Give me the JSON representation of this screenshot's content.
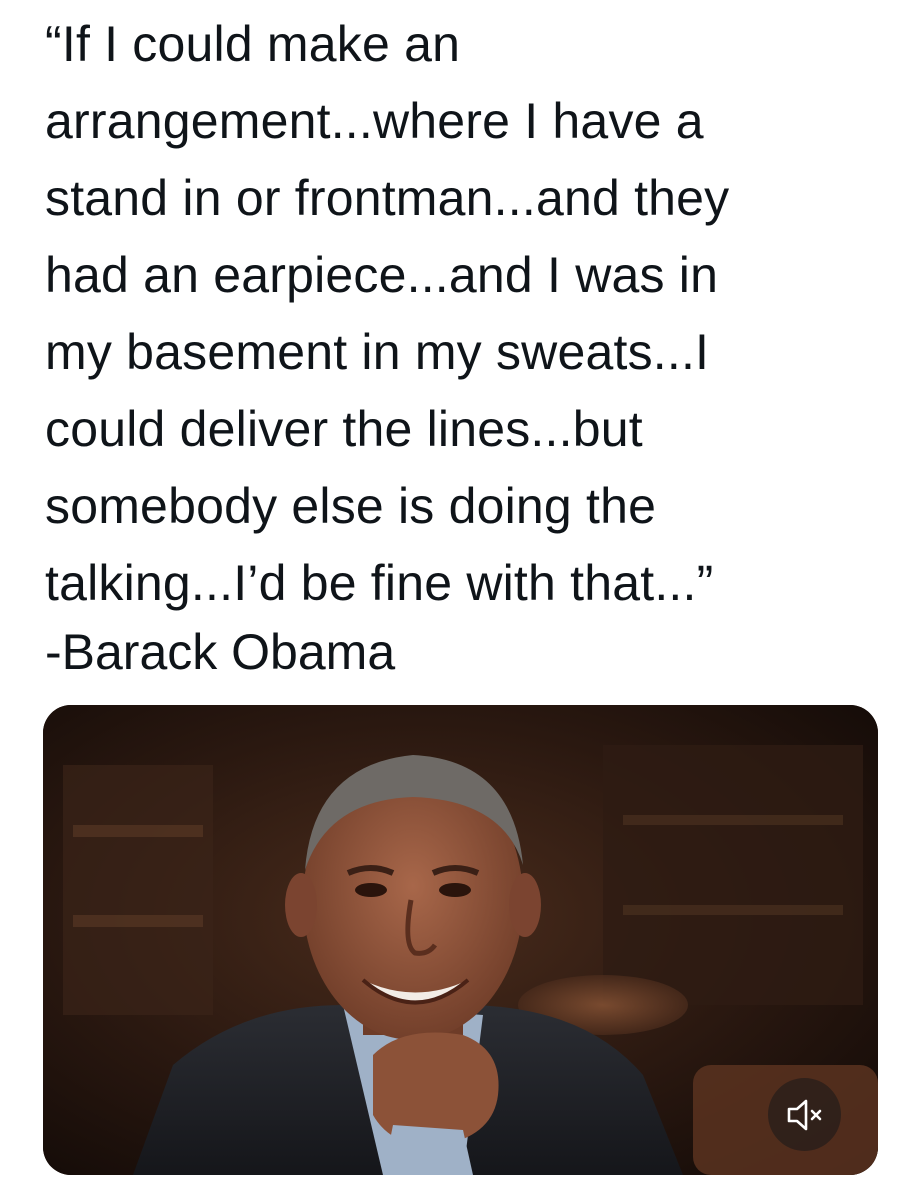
{
  "post": {
    "quote_lines": [
      "“If I could make an",
      "arrangement...where I have a",
      "stand in or frontman...and they",
      "had an earpiece...and I was in",
      "my basement in my sweats...I",
      "could deliver the lines...but",
      "somebody else is doing the",
      "talking...I’d be fine with that...”"
    ],
    "attribution": "-Barack Obama"
  },
  "media": {
    "type": "video",
    "mute_icon": "speaker-muted-icon",
    "muted": true
  }
}
